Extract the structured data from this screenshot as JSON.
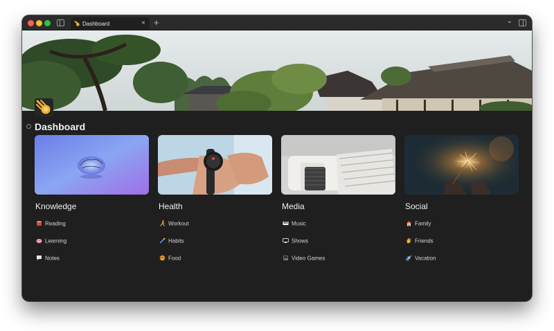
{
  "window": {
    "tab_title": "Dashboard",
    "tab_close": "×",
    "new_tab": "+",
    "tabs_menu": "⌄"
  },
  "page": {
    "title": "Dashboard"
  },
  "cards": [
    {
      "heading": "Knowledge",
      "image": "brain-image",
      "items": [
        {
          "label": "Reading",
          "icon": "book-icon"
        },
        {
          "label": "Learning",
          "icon": "brain-icon"
        },
        {
          "label": "Notes",
          "icon": "note-icon"
        }
      ]
    },
    {
      "heading": "Health",
      "image": "smartwatch-image",
      "items": [
        {
          "label": "Workout",
          "icon": "runner-icon"
        },
        {
          "label": "Habits",
          "icon": "wand-icon"
        },
        {
          "label": "Food",
          "icon": "food-icon"
        }
      ]
    },
    {
      "heading": "Media",
      "image": "couch-image",
      "items": [
        {
          "label": "Music",
          "icon": "piano-icon"
        },
        {
          "label": "Shows",
          "icon": "tv-icon"
        },
        {
          "label": "Video Games",
          "icon": "arcade-icon"
        }
      ]
    },
    {
      "heading": "Social",
      "image": "sparkler-image",
      "items": [
        {
          "label": "Family",
          "icon": "house-icon"
        },
        {
          "label": "Friends",
          "icon": "waving-hand-icon"
        },
        {
          "label": "Vacation",
          "icon": "airplane-icon"
        }
      ]
    }
  ],
  "colors": {
    "background": "#1f1f1f",
    "titlebar": "#2b2b2b",
    "text": "#f0f0f0",
    "muted_text": "#d4d4d4"
  }
}
